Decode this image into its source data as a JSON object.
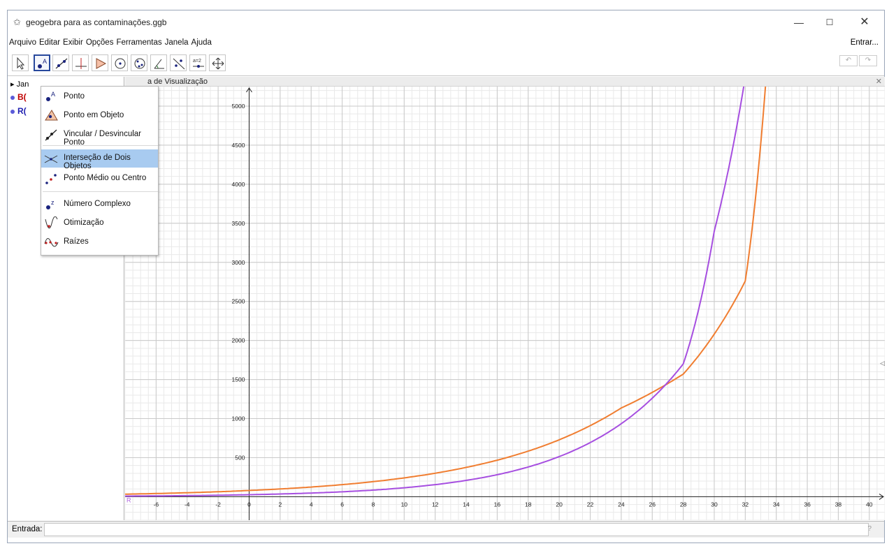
{
  "window": {
    "title": "geogebra para as contaminações.ggb"
  },
  "menubar": {
    "items": [
      "Arquivo",
      "Editar",
      "Exibir",
      "Opções",
      "Ferramentas",
      "Janela",
      "Ajuda"
    ],
    "right": "Entrar..."
  },
  "toolbar": {
    "undo": "↶",
    "redo": "↷",
    "tools": [
      {
        "name": "move-tool-icon"
      },
      {
        "name": "point-tool-icon"
      },
      {
        "name": "line-tool-icon"
      },
      {
        "name": "perpendicular-tool-icon"
      },
      {
        "name": "polygon-tool-icon"
      },
      {
        "name": "circle-tool-icon"
      },
      {
        "name": "conic-tool-icon"
      },
      {
        "name": "angle-tool-icon"
      },
      {
        "name": "reflect-tool-icon"
      },
      {
        "name": "slider-tool-icon"
      },
      {
        "name": "move-view-tool-icon"
      }
    ]
  },
  "algebra": {
    "header": "Jan",
    "items": [
      {
        "label": "B(",
        "color": "#c00000"
      },
      {
        "label": "R(",
        "color": "#1f1fb0"
      }
    ]
  },
  "graphics": {
    "header": "a de Visualização",
    "close": "✕"
  },
  "dropdown": {
    "items": [
      {
        "label": "Ponto",
        "icon": "point-icon"
      },
      {
        "label": "Ponto em Objeto",
        "icon": "point-on-object-icon"
      },
      {
        "label": "Vincular / Desvincular Ponto",
        "icon": "attach-detach-point-icon"
      },
      {
        "label": "Interseção de Dois Objetos",
        "icon": "intersect-icon",
        "highlighted": true
      },
      {
        "label": "Ponto Médio ou Centro",
        "icon": "midpoint-icon"
      },
      {
        "label": "Número Complexo",
        "icon": "complex-number-icon"
      },
      {
        "label": "Otimização",
        "icon": "optimization-icon"
      },
      {
        "label": "Raízes",
        "icon": "roots-icon"
      }
    ]
  },
  "chart_data": {
    "type": "line",
    "xlim": [
      -8,
      41
    ],
    "ylim": [
      -300,
      5250
    ],
    "x_ticks": [
      -6,
      -4,
      -2,
      0,
      2,
      4,
      6,
      8,
      10,
      12,
      14,
      16,
      18,
      20,
      22,
      24,
      26,
      28,
      30,
      32,
      34,
      36,
      38,
      40
    ],
    "y_ticks": [
      500,
      1000,
      1500,
      2000,
      2500,
      3000,
      3500,
      4000,
      4500,
      5000
    ],
    "origin_label": "R",
    "grid": true,
    "series": [
      {
        "color": "#f07d30",
        "x": [
          -8,
          -4,
          0,
          4,
          8,
          12,
          16,
          20,
          24,
          28,
          32,
          33.3
        ],
        "y": [
          33,
          51,
          80,
          124,
          193,
          301,
          468,
          729,
          1136,
          1570,
          2760,
          5250
        ]
      },
      {
        "color": "#a64ee0",
        "x": [
          -8,
          -4,
          0,
          4,
          8,
          12,
          16,
          20,
          24,
          28,
          30,
          31.9
        ],
        "y": [
          8,
          14,
          26,
          47,
          85,
          155,
          282,
          514,
          935,
          1700,
          3400,
          5250
        ]
      }
    ]
  },
  "inputbar": {
    "label": "Entrada:",
    "placeholder": "",
    "help": "?"
  }
}
